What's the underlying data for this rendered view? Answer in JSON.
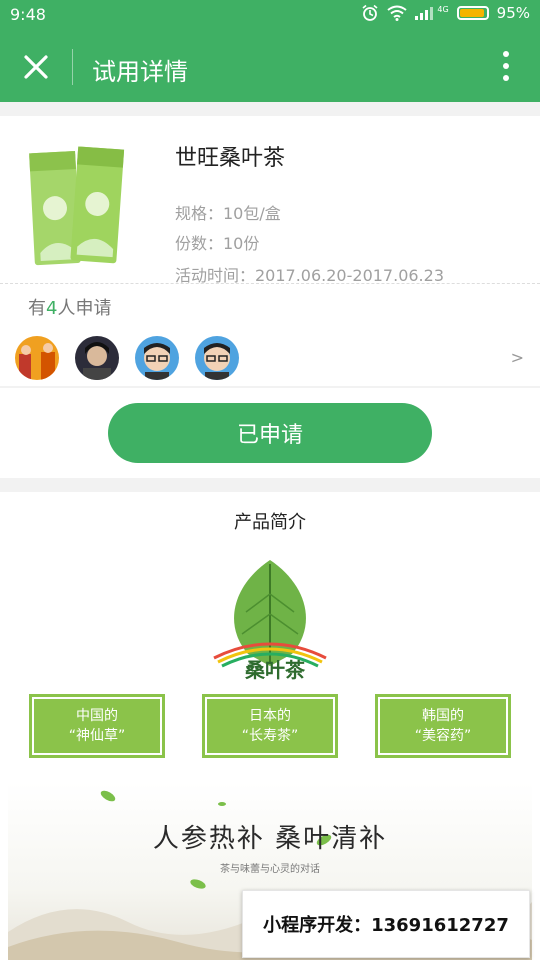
{
  "status_bar": {
    "time": "9:48",
    "network": "4G",
    "battery_percent": "95%",
    "battery_level": 0.95
  },
  "header": {
    "title": "试用详情"
  },
  "product": {
    "name": "世旺桑叶茶",
    "spec": "规格：10包/盒",
    "quantity": "份数：10份",
    "period": "活动时间：2017.06.20-2017.06.23"
  },
  "applicants": {
    "prefix": "有",
    "count": "4",
    "suffix": "人申请",
    "more": ">"
  },
  "apply_button": {
    "label": "已申请"
  },
  "intro": {
    "title": "产品简介",
    "brand": "桑叶茶",
    "boxes": [
      {
        "line1": "中国的",
        "line2": "“神仙草”"
      },
      {
        "line1": "日本的",
        "line2": "“长寿茶”"
      },
      {
        "line1": "韩国的",
        "line2": "“美容药”"
      }
    ],
    "slogan": "人参热补 桑叶清补",
    "sub_slogan": "茶与味蕾与心灵的对话"
  },
  "ad": {
    "text": "小程序开发：13691612727"
  },
  "colors": {
    "primary": "#3fb064",
    "box_green": "#8bc34a",
    "accent_number": "#3fb064"
  }
}
